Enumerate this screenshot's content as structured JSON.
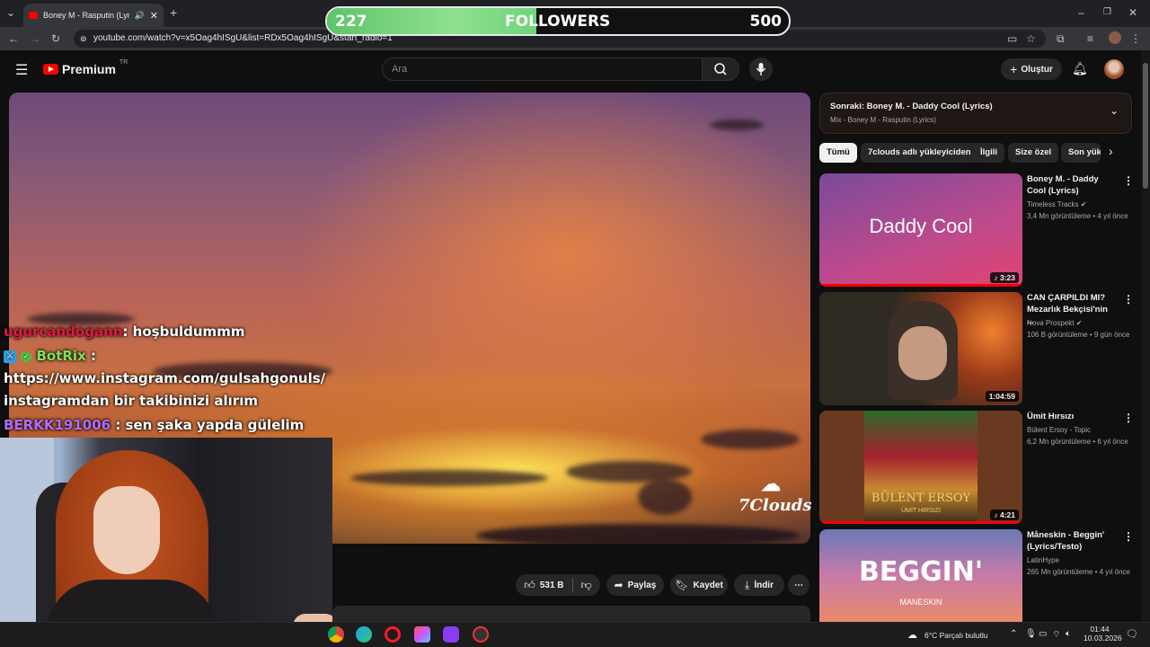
{
  "browser": {
    "tab_title": "Boney M - Rasputin (Lyrics)",
    "url": "youtube.com/watch?v=x5Oag4hISgU&list=RDx5Oag4hISgU&start_radio=1"
  },
  "overlay": {
    "followers_current": "227",
    "followers_label": "FOLLOWERS",
    "followers_goal": "500",
    "followers_progress": 0.454
  },
  "youtube": {
    "logo_text": "Premium",
    "logo_region": "TR",
    "search_placeholder": "Ara",
    "create_label": "Oluştur"
  },
  "video": {
    "watermark": "7Clouds",
    "actions": {
      "like_count": "531 B",
      "share_label": "Paylaş",
      "save_label": "Kaydet",
      "download_label": "İndir"
    }
  },
  "chat": [
    {
      "user": "ugurcandogann",
      "message": ": hoşbuldummm",
      "user_color": "#e0193f"
    },
    {
      "user": "BotRix",
      "message": " :",
      "user_color": "#7ee05a"
    },
    {
      "user": "",
      "message": "https://www.instagram.com/gulsahgonuls/",
      "user_color": "#ffffff"
    },
    {
      "user": "",
      "message": "instagramdan bir takibinizi alırım",
      "user_color": "#ffffff"
    },
    {
      "user": "BERKK191006",
      "message": " : sen şaka yapda gülelim",
      "user_color": "#b36bff"
    }
  ],
  "sidebar": {
    "upnext_title": "Sonraki: Boney M. - Daddy Cool (Lyrics)",
    "upnext_subtitle": "Mix - Boney M - Rasputin (Lyrics)",
    "chips": [
      "Tümü",
      "7clouds adlı yükleyiciden",
      "İlgili",
      "Size özel",
      "Son yük"
    ],
    "videos": [
      {
        "title": "Boney M. - Daddy Cool (Lyrics)",
        "channel": "Timeless Tracks",
        "meta": "3,4 Mn görüntüleme • 4 yıl önce",
        "duration": "3:23",
        "thumb_text": "Daddy Cool"
      },
      {
        "title": "CAN ÇARPILDI MI? Mezarlık Bekçisi'nin ...",
        "channel": "Nova Prospekt",
        "meta": "106 B görüntüleme • 9 gün önce",
        "duration": "1:04:59",
        "thumb_text": ""
      },
      {
        "title": "Ümit Hırsızı",
        "channel": "Bülent Ersoy - Topic",
        "meta": "6,2 Mn görüntüleme • 6 yıl önce",
        "duration": "4:21",
        "thumb_text": "BÜLENT ERSOY",
        "thumb_sub": "ÜMİT HIRSIZI"
      },
      {
        "title": "Måneskin - Beggin' (Lyrics/Testo)",
        "channel": "LatinHype",
        "meta": "265 Mn görüntüleme • 4 yıl önce",
        "duration": "",
        "thumb_text": "BEGGIN'",
        "thumb_sub": "MANESKIN"
      }
    ]
  },
  "taskbar": {
    "weather": "6°C  Parçalı bulutlu",
    "time": "01:44",
    "date": "10.03.2026"
  }
}
